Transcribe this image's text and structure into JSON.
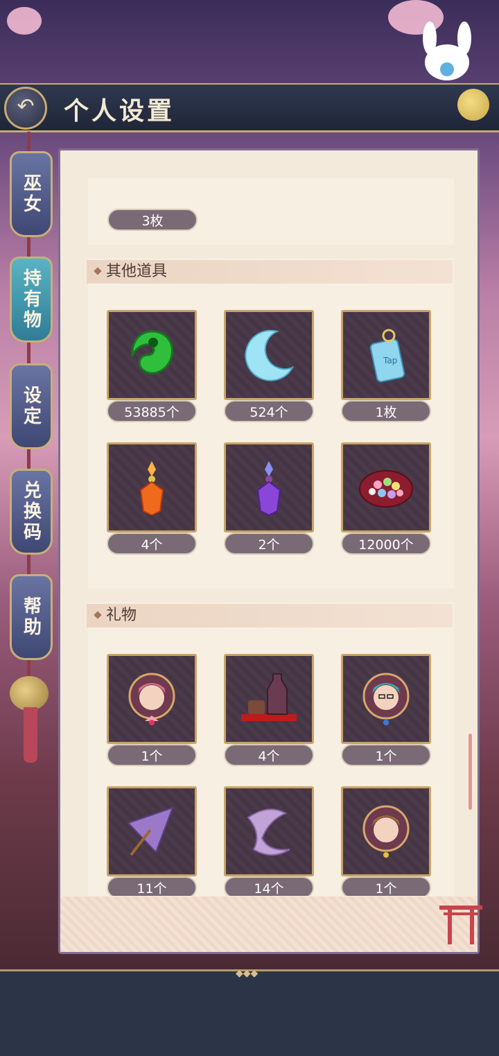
{
  "header": {
    "title": "个人设置"
  },
  "sidebar": {
    "tabs": [
      {
        "label": "巫女",
        "active": false
      },
      {
        "label": "持有物",
        "active": true
      },
      {
        "label": "设定",
        "active": false
      },
      {
        "label": "兑换码",
        "active": false
      },
      {
        "label": "帮助",
        "active": false
      }
    ]
  },
  "previous_section": {
    "last_count": "3枚"
  },
  "sections": [
    {
      "title": "其他道具",
      "items": [
        {
          "icon": "green-magatama-icon",
          "count": "53885个"
        },
        {
          "icon": "crescent-moon-icon",
          "count": "524个"
        },
        {
          "icon": "tap-omamori-charm-icon",
          "count": "1枚"
        },
        {
          "icon": "orange-crystal-bottle-icon",
          "count": "4个"
        },
        {
          "icon": "purple-crystal-bottle-icon",
          "count": "2个"
        },
        {
          "icon": "konpeito-candy-box-icon",
          "count": "12000个"
        }
      ]
    },
    {
      "title": "礼物",
      "items": [
        {
          "icon": "pink-hair-portrait-icon",
          "count": "1个"
        },
        {
          "icon": "sake-set-icon",
          "count": "4个"
        },
        {
          "icon": "teal-hair-glasses-portrait-icon",
          "count": "1个"
        },
        {
          "icon": "purple-umbrella-icon",
          "count": "11个"
        },
        {
          "icon": "purple-ribbon-icon",
          "count": "14个"
        },
        {
          "icon": "brown-hair-portrait-icon",
          "count": "1个"
        }
      ]
    }
  ],
  "colors": {
    "accent_gold": "#c9ab72",
    "panel": "#f3eadb",
    "count_pill": "#7a6a76",
    "active_tab": "#2f7c96"
  }
}
